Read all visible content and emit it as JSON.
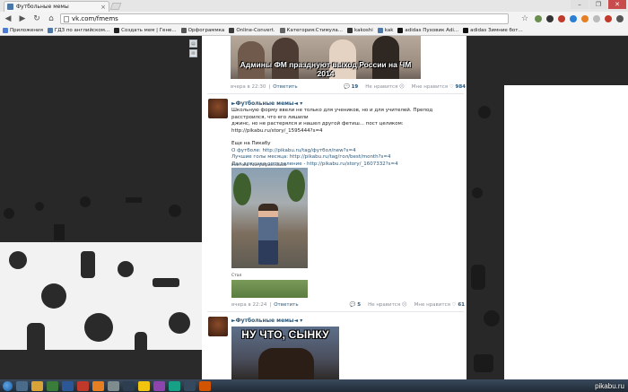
{
  "browser": {
    "tab_title": "Футбольные мемы",
    "tab_close": "×",
    "win_min": "–",
    "win_max": "❐",
    "win_close": "✕",
    "back": "◀",
    "forward": "▶",
    "reload": "↻",
    "home": "⌂",
    "url": "vk.com/fmems",
    "star": "☆"
  },
  "bookmarks": [
    {
      "label": "Приложения",
      "color": "#4b7bd6"
    },
    {
      "label": "ГДЗ по английском...",
      "color": "#4a76a8"
    },
    {
      "label": "Создать мем | Гене...",
      "color": "#222222"
    },
    {
      "label": "Орфограммка",
      "color": "#555555"
    },
    {
      "label": "Online-Convert.",
      "color": "#3a3a3a"
    },
    {
      "label": "Категория:Стимула...",
      "color": "#666666"
    },
    {
      "label": "kakoshi",
      "color": "#333333"
    },
    {
      "label": "kak",
      "color": "#4a76a8"
    },
    {
      "label": "adidas Пуховик Adi...",
      "color": "#111111"
    },
    {
      "label": "adidas Зимние бот...",
      "color": "#111111"
    }
  ],
  "side_buttons": [
    "▤",
    "✉"
  ],
  "post1": {
    "caption": "Админы ФМ празднуют выход России на ЧМ 2014",
    "time": "вчера в 22:30",
    "reply": "Ответить",
    "comments": "19",
    "dislike": "Не нравится ☹",
    "like": "Мне нравится ♡",
    "like_count": "984"
  },
  "post2": {
    "author": "►Футбольные мемы◄ ▾",
    "lines": [
      "Школьную форму ввели не только для учеников, но и для учителей. Препод расстроился, что его лишили",
      "джинс, но не растерялся и нашел другой фетиш... пост целиком: http://pikabu.ru/story/_1595444?s=4",
      "",
      "Еще на Пикабу",
      "О футболе: http://pikabu.ru/tag/футбол/new?s=4",
      "Лучшие голы месяца: http://pikabu.ru/tag/гол/best/month?s=4",
      "Дал девушке определение - http://pikabu.ru/story/_1607332?s=4"
    ],
    "photo1_caption": "Учитель географии. Было",
    "photo2_caption": "Стал",
    "time": "вчера в 22:24",
    "reply": "Ответить",
    "comments": "5",
    "dislike": "Не нравится ☹",
    "like": "Мне нравится ♡",
    "like_count": "61"
  },
  "post3": {
    "author": "►Футбольные мемы◄ ▾",
    "caption": "НУ ЧТО, СЫНКУ"
  },
  "watermark": "pikabu.ru"
}
